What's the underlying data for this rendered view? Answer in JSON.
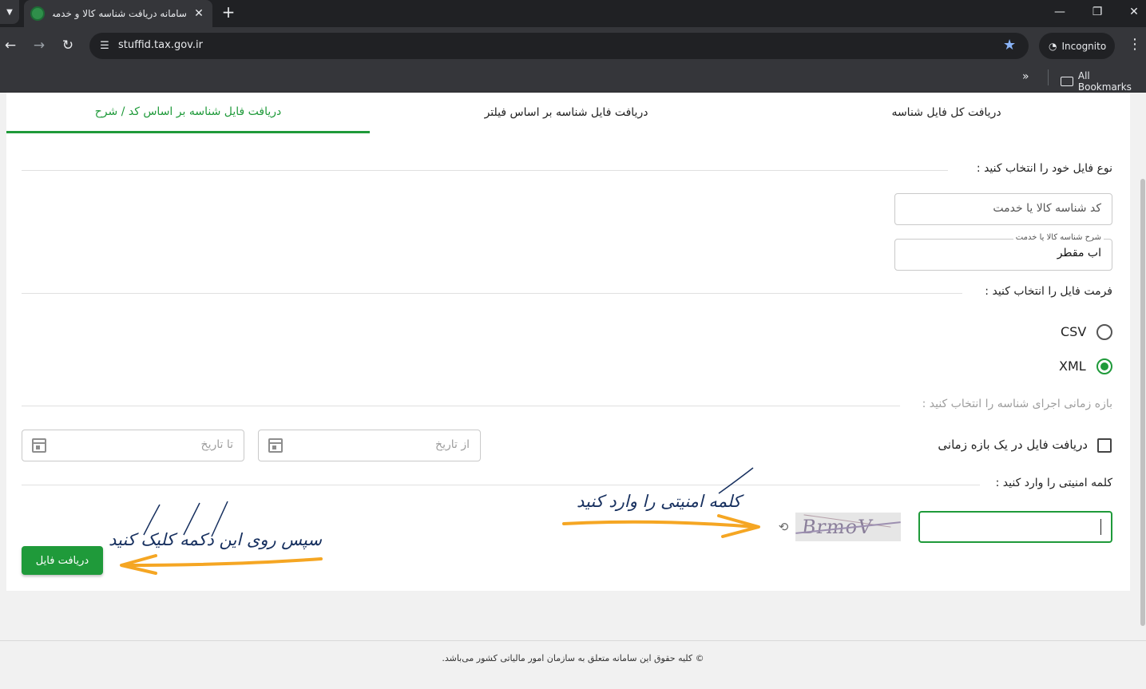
{
  "browser": {
    "tab_title": "سامانه دریافت شناسه کالا و خدمت",
    "url": "stuffid.tax.gov.ir",
    "incognito_label": "Incognito",
    "all_bookmarks_label": "All Bookmarks",
    "icons": {
      "tab_list": "chevron-down-icon",
      "close_tab": "close-icon",
      "new_tab": "plus-icon",
      "minimize": "minimize-icon",
      "restore": "restore-icon",
      "close_window": "close-icon",
      "back": "arrow-left-icon",
      "forward": "arrow-right-icon",
      "reload": "reload-icon",
      "site_info": "tune-icon",
      "bookmark": "star-icon",
      "incognito": "incognito-icon",
      "menu": "kebab-icon",
      "more_bookmarks": "double-chevron-icon",
      "folder": "folder-icon"
    }
  },
  "tabs": [
    {
      "label": "دریافت کل فایل شناسه",
      "active": false
    },
    {
      "label": "دریافت فایل شناسه بر اساس فیلتر",
      "active": false
    },
    {
      "label": "دریافت فایل شناسه بر اساس کد / شرح",
      "active": true
    }
  ],
  "form": {
    "file_type_label": "نوع فایل خود را انتخاب کنید :",
    "code_placeholder": "کد شناسه کالا یا خدمت",
    "desc_legend": "شرح شناسه کالا یا خدمت",
    "desc_value": "اب مقطر",
    "format_label": "فرمت فایل را انتخاب کنید :",
    "formats": [
      {
        "label": "CSV",
        "selected": false
      },
      {
        "label": "XML",
        "selected": true
      }
    ],
    "period_label": "بازه زمانی اجرای شناسه را انتخاب کنید :",
    "period_checkbox_label": "دریافت فایل در یک بازه زمانی",
    "period_checked": false,
    "from_date_placeholder": "از تاریخ",
    "to_date_placeholder": "تا تاریخ",
    "captcha_label": "کلمه امنیتی را وارد کنید :",
    "captcha_value": "",
    "captcha_text": "BrmoV",
    "submit_label": "دریافت فایل"
  },
  "annotations": {
    "captcha_hint": "کلمه امنیتی را وارد کنید",
    "button_hint": "سپس روی این دکمه کلیک کنید",
    "arrow_color": "#f5a623",
    "ink_color": "#17305f"
  },
  "footer": {
    "text": "© کلیه حقوق این سامانه متعلق به سازمان امور مالیاتی کشور می‌باشد."
  },
  "colors": {
    "accent": "#1f9a3a",
    "browser_dark": "#202124",
    "browser_toolbar": "#35363a"
  }
}
